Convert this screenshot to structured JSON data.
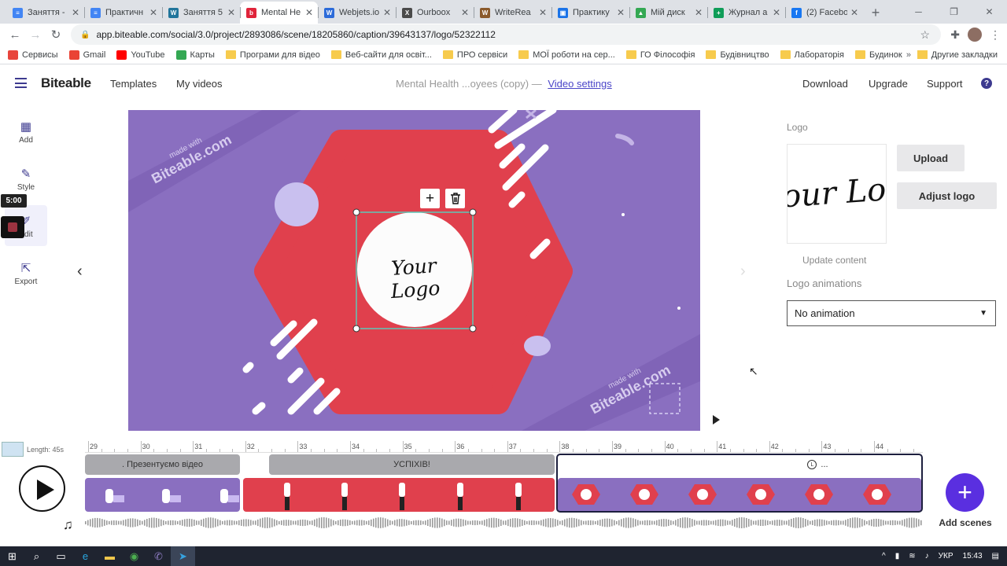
{
  "browser": {
    "tabs": [
      {
        "title": "Заняття - ",
        "color": "#4285f4",
        "glyph": "≡"
      },
      {
        "title": "Практичн",
        "color": "#4285f4",
        "glyph": "≡"
      },
      {
        "title": "Заняття 5",
        "color": "#21759b",
        "glyph": "W"
      },
      {
        "title": "Mental He",
        "color": "#e0243a",
        "glyph": "b"
      },
      {
        "title": "Webjets.io",
        "color": "#2c6bd9",
        "glyph": "W"
      },
      {
        "title": "Ourboox",
        "color": "#4a4a4a",
        "glyph": "X"
      },
      {
        "title": "WriteRea",
        "color": "#8a5a2b",
        "glyph": "W"
      },
      {
        "title": "Практику",
        "color": "#1a73e8",
        "glyph": "▣"
      },
      {
        "title": "Мій диск",
        "color": "#34a853",
        "glyph": "▲"
      },
      {
        "title": "Журнал а",
        "color": "#0f9d58",
        "glyph": "+"
      },
      {
        "title": "(2) Facebo",
        "color": "#1877f2",
        "glyph": "f"
      }
    ],
    "url": "app.biteable.com/social/3.0/project/2893086/scene/18205860/caption/39643137/logo/52322112",
    "bookmarks": [
      {
        "label": "Сервисы",
        "kind": "apps"
      },
      {
        "label": "Gmail",
        "kind": "gmail"
      },
      {
        "label": "YouTube",
        "kind": "youtube"
      },
      {
        "label": "Карты",
        "kind": "maps"
      },
      {
        "label": "Програми для відео",
        "kind": "folder"
      },
      {
        "label": "Веб-сайти для освіт...",
        "kind": "folder"
      },
      {
        "label": "ПРО сервіси",
        "kind": "folder"
      },
      {
        "label": "МОЇ роботи на сер...",
        "kind": "folder"
      },
      {
        "label": "ГО Філософія",
        "kind": "folder"
      },
      {
        "label": "Будівництво",
        "kind": "folder"
      },
      {
        "label": "Лабораторія",
        "kind": "folder"
      },
      {
        "label": "Будинок",
        "kind": "folder"
      }
    ],
    "bookmarks_more": "»",
    "bookmarks_other": "Другие закладки"
  },
  "header": {
    "brand": "Biteable",
    "templates": "Templates",
    "my_videos": "My videos",
    "project_title": "Mental Health ...oyees (copy)",
    "separator": "—",
    "video_settings": "Video settings",
    "download": "Download",
    "upgrade": "Upgrade",
    "support": "Support",
    "help": "?"
  },
  "rail": {
    "add": "Add",
    "style": "Style",
    "edit": "Edit",
    "export": "Export",
    "time_badge": "5:00"
  },
  "canvas": {
    "logo_text": "Your Logo",
    "watermark_line1": "made with",
    "watermark_line2": "Biteable.com"
  },
  "panel": {
    "title": "Logo",
    "upload": "Upload",
    "adjust": "Adjust logo",
    "update": "Update content",
    "anim_label": "Logo animations",
    "anim_value": "No animation"
  },
  "timeline": {
    "length": "Length: 45s",
    "ticks": [
      "29",
      "30",
      "31",
      "32",
      "33",
      "34",
      "35",
      "36",
      "37",
      "38",
      "39",
      "40",
      "41",
      "42",
      "43",
      "44"
    ],
    "caption1": ". Презентуємо відео",
    "caption2": "УСПІХІВ!",
    "caption3": "...",
    "add_scenes": "Add scenes"
  },
  "taskbar": {
    "lang": "УКР",
    "time": "15:43"
  },
  "colors": {
    "purple_scene": "#8a6fc0",
    "red_scene": "#e0404d",
    "accent": "#5a2fe0",
    "brand_nav": "#3d3a8f"
  }
}
